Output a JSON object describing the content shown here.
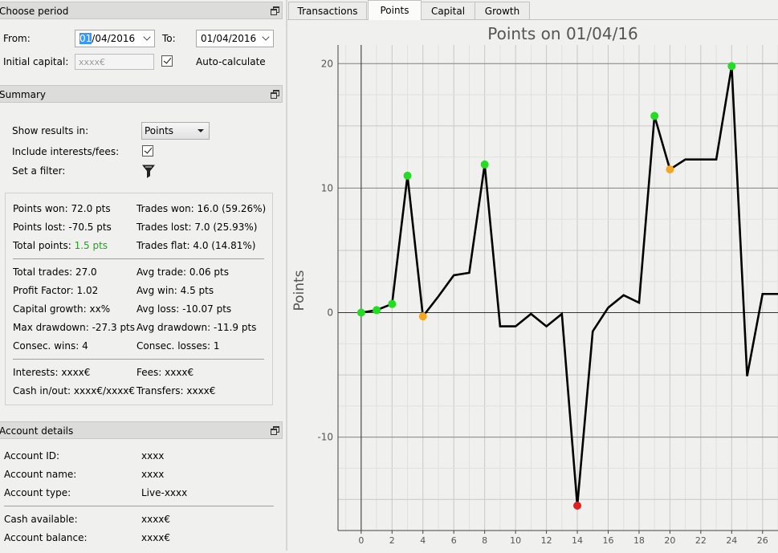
{
  "period": {
    "title": "Choose period",
    "from_label": "From:",
    "from_value_selected": "01",
    "from_value_rest": "/04/2016",
    "to_label": "To:",
    "to_value": "01/04/2016",
    "initial_capital_label": "Initial capital:",
    "initial_capital_placeholder": "xxxx€",
    "auto_calculate_label": "Auto-calculate",
    "auto_calculate_checked": true
  },
  "summary": {
    "title": "Summary",
    "show_results_label": "Show results in:",
    "show_results_value": "Points",
    "include_interests_label": "Include interests/fees:",
    "include_interests_checked": true,
    "filter_label": "Set a filter:",
    "stats_left_1": [
      {
        "label": "Points won: ",
        "value": "72.0 pts"
      },
      {
        "label": "Points lost: ",
        "value": "-70.5 pts"
      },
      {
        "label": "Total points: ",
        "value": "1.5 pts"
      }
    ],
    "stats_right_1": [
      {
        "label": "Trades won: ",
        "value": "16.0 (59.26%)"
      },
      {
        "label": "Trades lost: ",
        "value": "7.0 (25.93%)"
      },
      {
        "label": "Trades flat: ",
        "value": "4.0 (14.81%)"
      }
    ],
    "stats_left_2": [
      {
        "label": "Total trades: ",
        "value": "27.0"
      },
      {
        "label": "Profit Factor: ",
        "value": "1.02"
      },
      {
        "label": "Capital growth: ",
        "value": "xx%"
      },
      {
        "label": "Max drawdown: ",
        "value": "-27.3 pts"
      },
      {
        "label": "Consec. wins: ",
        "value": "4"
      }
    ],
    "stats_right_2": [
      {
        "label": "Avg trade: ",
        "value": "0.06 pts"
      },
      {
        "label": "Avg win: ",
        "value": "4.5 pts"
      },
      {
        "label": "Avg loss: ",
        "value": "-10.07 pts"
      },
      {
        "label": "Avg drawdown: ",
        "value": "-11.9 pts"
      },
      {
        "label": "Consec. losses: ",
        "value": "1"
      }
    ],
    "stats_left_3": [
      {
        "label": "Interests: ",
        "value": "xxxx€"
      },
      {
        "label": "Cash in/out: ",
        "value": "xxxx€/xxxx€"
      }
    ],
    "stats_right_3": [
      {
        "label": "Fees: ",
        "value": "xxxx€"
      },
      {
        "label": "Transfers: ",
        "value": "xxxx€"
      }
    ],
    "positive_color": "#1aa51a"
  },
  "account": {
    "title": "Account details",
    "rows": [
      {
        "label": "Account ID:",
        "value": "xxxx"
      },
      {
        "label": "Account name:",
        "value": "xxxx"
      },
      {
        "label": "Account type:",
        "value": "Live-xxxx"
      }
    ],
    "rows2": [
      {
        "label": "Cash available:",
        "value": "xxxx€"
      },
      {
        "label": "Account balance:",
        "value": "xxxx€"
      }
    ]
  },
  "tabs": [
    {
      "label": "Transactions",
      "active": false
    },
    {
      "label": "Points",
      "active": true
    },
    {
      "label": "Capital",
      "active": false
    },
    {
      "label": "Growth",
      "active": false
    }
  ],
  "chart_data": {
    "type": "line",
    "title": "Points on 01/04/16",
    "ylabel": "Points",
    "xlabel": "",
    "xlim": [
      -1.5,
      27
    ],
    "ylim": [
      -17.5,
      21.5
    ],
    "xticks": [
      0,
      2,
      4,
      6,
      8,
      10,
      12,
      14,
      16,
      18,
      20,
      22,
      24,
      26
    ],
    "yticks": [
      -10,
      0,
      10,
      20
    ],
    "grid": true,
    "line_color": "#000000",
    "x": [
      0,
      1,
      2,
      3,
      4,
      5,
      6,
      7,
      8,
      9,
      10,
      11,
      12,
      13,
      14,
      15,
      16,
      17,
      18,
      19,
      20,
      21,
      22,
      23,
      24,
      25,
      26,
      27
    ],
    "y": [
      0,
      0.2,
      0.7,
      11.0,
      -0.3,
      1.3,
      3.0,
      3.2,
      11.9,
      -1.1,
      -1.1,
      -0.1,
      -1.1,
      -0.1,
      -15.5,
      -1.5,
      0.4,
      1.4,
      0.8,
      15.8,
      11.5,
      12.3,
      12.3,
      12.3,
      19.8,
      -5.1,
      1.5,
      1.5
    ],
    "markers": [
      {
        "x": 0,
        "y": 0,
        "color": "#22dd22"
      },
      {
        "x": 1,
        "y": 0.2,
        "color": "#22dd22"
      },
      {
        "x": 2,
        "y": 0.7,
        "color": "#22dd22"
      },
      {
        "x": 3,
        "y": 11.0,
        "color": "#22dd22"
      },
      {
        "x": 4,
        "y": -0.3,
        "color": "#f5a623"
      },
      {
        "x": 8,
        "y": 11.9,
        "color": "#22dd22"
      },
      {
        "x": 14,
        "y": -15.5,
        "color": "#e02020"
      },
      {
        "x": 19,
        "y": 15.8,
        "color": "#22dd22"
      },
      {
        "x": 20,
        "y": 11.5,
        "color": "#f5a623"
      },
      {
        "x": 24,
        "y": 19.8,
        "color": "#22dd22"
      }
    ]
  }
}
